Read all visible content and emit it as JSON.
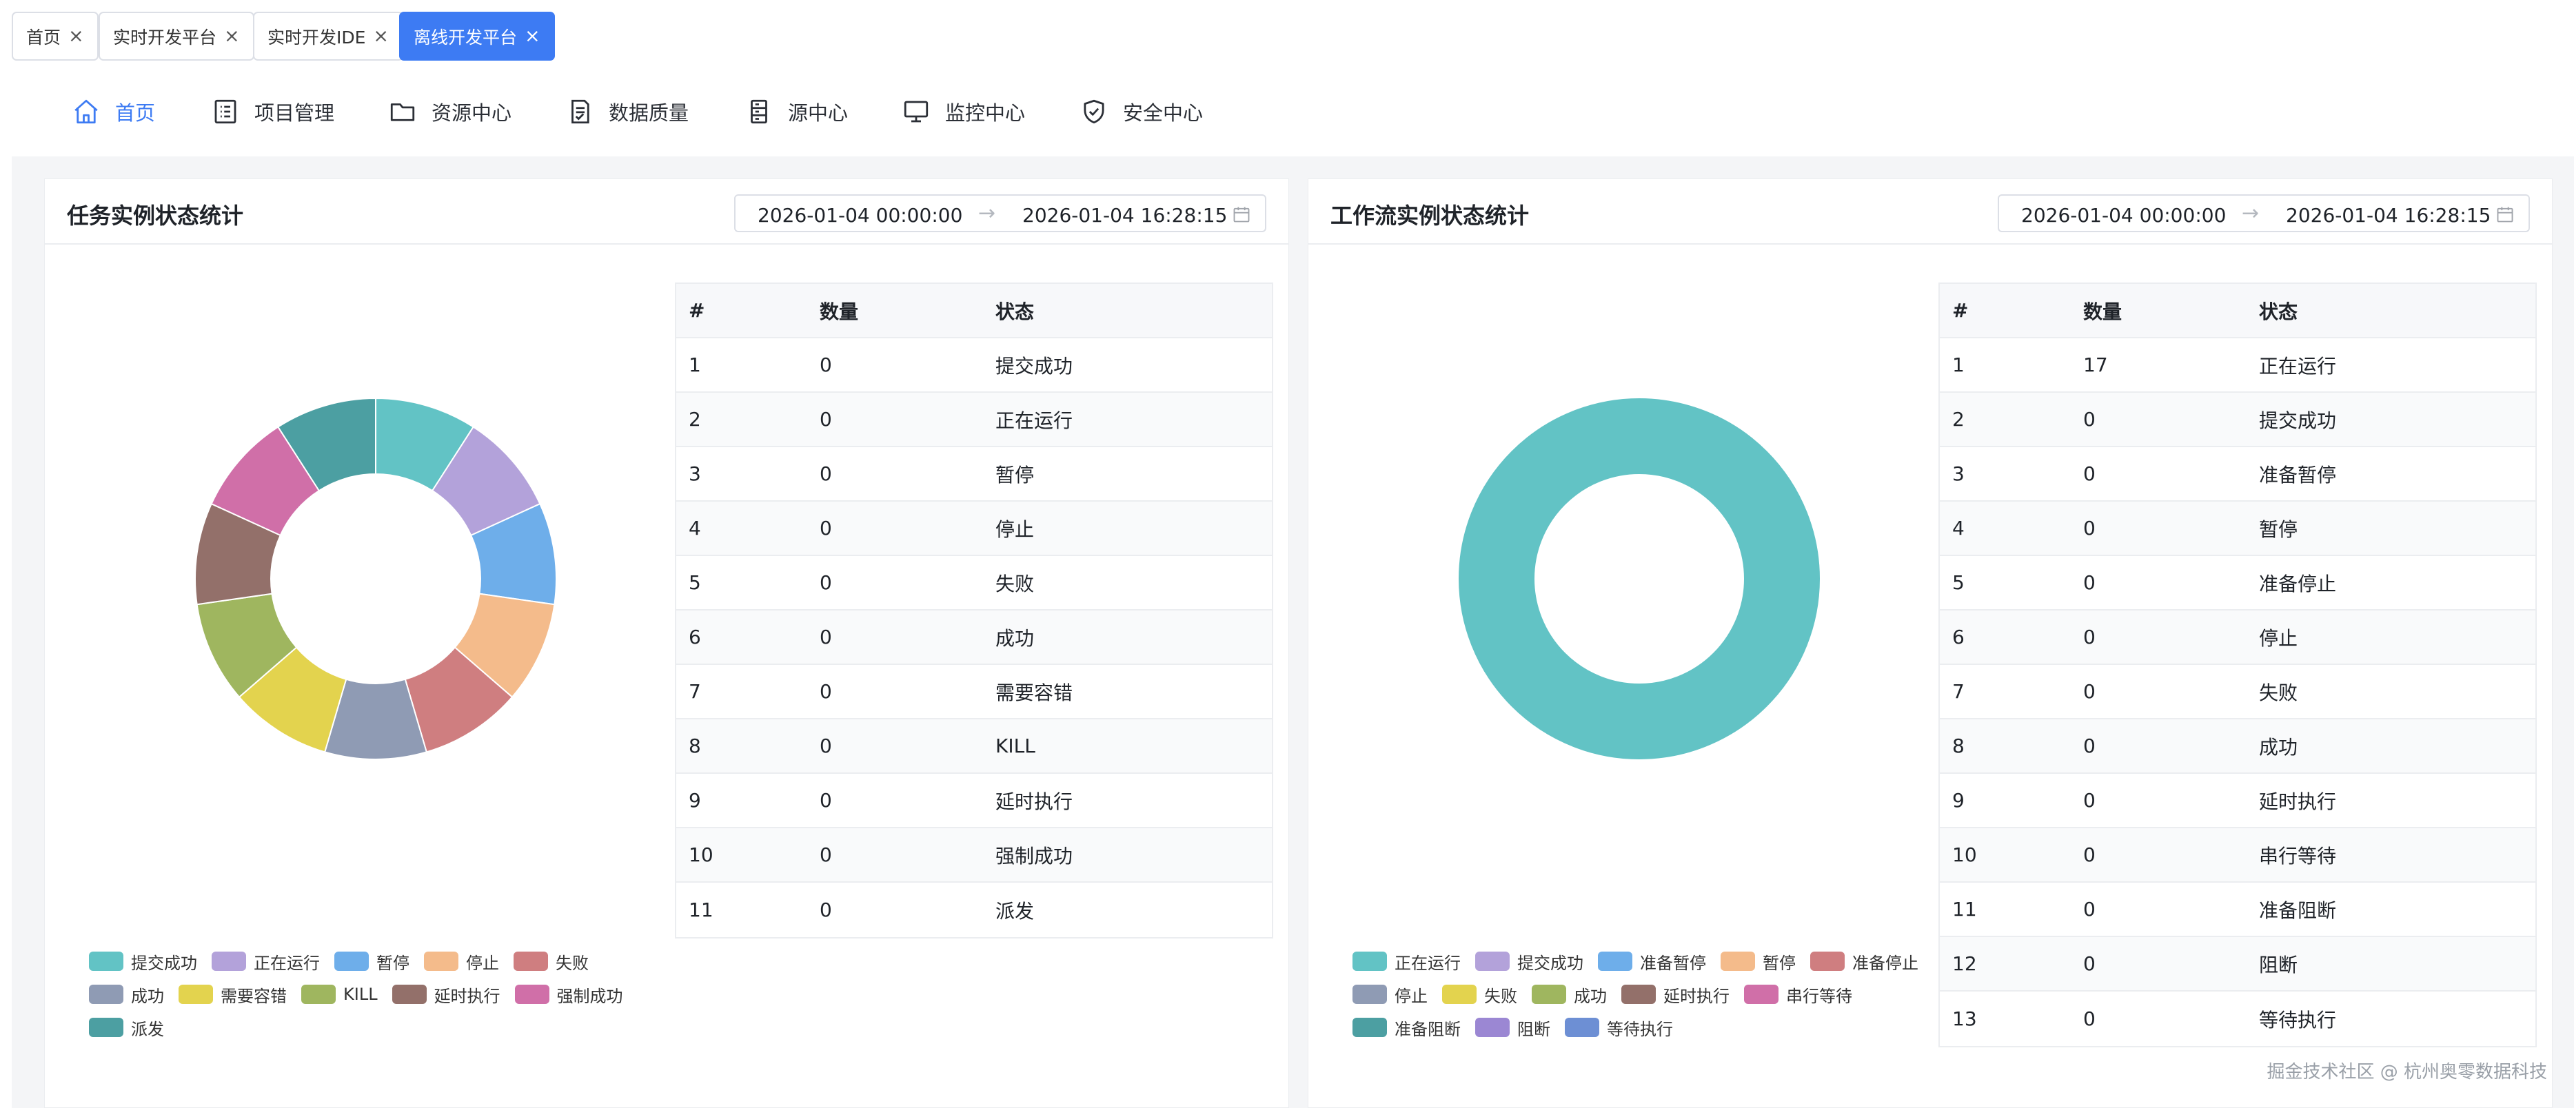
{
  "tabs": [
    {
      "label": "首页",
      "active": false
    },
    {
      "label": "实时开发平台",
      "active": false
    },
    {
      "label": "实时开发IDE",
      "active": false
    },
    {
      "label": "离线开发平台",
      "active": true
    }
  ],
  "nav": [
    {
      "label": "首页",
      "icon": "home-icon",
      "active": true
    },
    {
      "label": "项目管理",
      "icon": "project-list-icon",
      "active": false
    },
    {
      "label": "资源中心",
      "icon": "folder-icon",
      "active": false
    },
    {
      "label": "数据质量",
      "icon": "document-check-icon",
      "active": false
    },
    {
      "label": "源中心",
      "icon": "server-icon",
      "active": false
    },
    {
      "label": "监控中心",
      "icon": "monitor-icon",
      "active": false
    },
    {
      "label": "安全中心",
      "icon": "shield-check-icon",
      "active": false
    }
  ],
  "task_panel": {
    "title": "任务实例状态统计",
    "range_start": "2026-01-04 00:00:00",
    "range_end": "2026-01-04 16:28:15",
    "columns": [
      "#",
      "数量",
      "状态"
    ],
    "rows": [
      {
        "idx": "1",
        "count": "0",
        "status": "提交成功"
      },
      {
        "idx": "2",
        "count": "0",
        "status": "正在运行"
      },
      {
        "idx": "3",
        "count": "0",
        "status": "暂停"
      },
      {
        "idx": "4",
        "count": "0",
        "status": "停止"
      },
      {
        "idx": "5",
        "count": "0",
        "status": "失败"
      },
      {
        "idx": "6",
        "count": "0",
        "status": "成功"
      },
      {
        "idx": "7",
        "count": "0",
        "status": "需要容错"
      },
      {
        "idx": "8",
        "count": "0",
        "status": "KILL"
      },
      {
        "idx": "9",
        "count": "0",
        "status": "延时执行"
      },
      {
        "idx": "10",
        "count": "0",
        "status": "强制成功"
      },
      {
        "idx": "11",
        "count": "0",
        "status": "派发"
      }
    ]
  },
  "workflow_panel": {
    "title": "工作流实例状态统计",
    "range_start": "2026-01-04 00:00:00",
    "range_end": "2026-01-04 16:28:15",
    "columns": [
      "#",
      "数量",
      "状态"
    ],
    "rows": [
      {
        "idx": "1",
        "count": "17",
        "status": "正在运行"
      },
      {
        "idx": "2",
        "count": "0",
        "status": "提交成功"
      },
      {
        "idx": "3",
        "count": "0",
        "status": "准备暂停"
      },
      {
        "idx": "4",
        "count": "0",
        "status": "暂停"
      },
      {
        "idx": "5",
        "count": "0",
        "status": "准备停止"
      },
      {
        "idx": "6",
        "count": "0",
        "status": "停止"
      },
      {
        "idx": "7",
        "count": "0",
        "status": "失败"
      },
      {
        "idx": "8",
        "count": "0",
        "status": "成功"
      },
      {
        "idx": "9",
        "count": "0",
        "status": "延时执行"
      },
      {
        "idx": "10",
        "count": "0",
        "status": "串行等待"
      },
      {
        "idx": "11",
        "count": "0",
        "status": "准备阻断"
      },
      {
        "idx": "12",
        "count": "0",
        "status": "阻断"
      },
      {
        "idx": "13",
        "count": "0",
        "status": "等待执行"
      }
    ]
  },
  "chart_data": [
    {
      "type": "pie",
      "categories": [
        "提交成功",
        "正在运行",
        "暂停",
        "停止",
        "失败",
        "成功",
        "需要容错",
        "KILL",
        "延时执行",
        "强制成功",
        "派发"
      ],
      "values": [
        0,
        0,
        0,
        0,
        0,
        0,
        0,
        0,
        0,
        0,
        0
      ],
      "colors": [
        "#62c3c5",
        "#b3a2da",
        "#6eaeea",
        "#f4bb8b",
        "#cf7e80",
        "#8f9bb4",
        "#e3d34e",
        "#9fb65f",
        "#93706a",
        "#d06fa8",
        "#4c9fa2"
      ],
      "donut": true,
      "legend": "bottom-left"
    },
    {
      "type": "pie",
      "categories": [
        "正在运行",
        "提交成功",
        "准备暂停",
        "暂停",
        "准备停止",
        "停止",
        "失败",
        "成功",
        "延时执行",
        "串行等待",
        "准备阻断",
        "阻断",
        "等待执行"
      ],
      "values": [
        17,
        0,
        0,
        0,
        0,
        0,
        0,
        0,
        0,
        0,
        0,
        0,
        0
      ],
      "colors": [
        "#62c3c5",
        "#b3a2da",
        "#6eaeea",
        "#f4bb8b",
        "#cf7e80",
        "#8f9bb4",
        "#e3d34e",
        "#9fb65f",
        "#93706a",
        "#d06fa8",
        "#4c9fa2",
        "#9b87d3",
        "#6d8fd4"
      ],
      "donut": true,
      "legend": "bottom-left"
    }
  ],
  "watermark": "掘金技术社区 @ 杭州奥零数据科技"
}
